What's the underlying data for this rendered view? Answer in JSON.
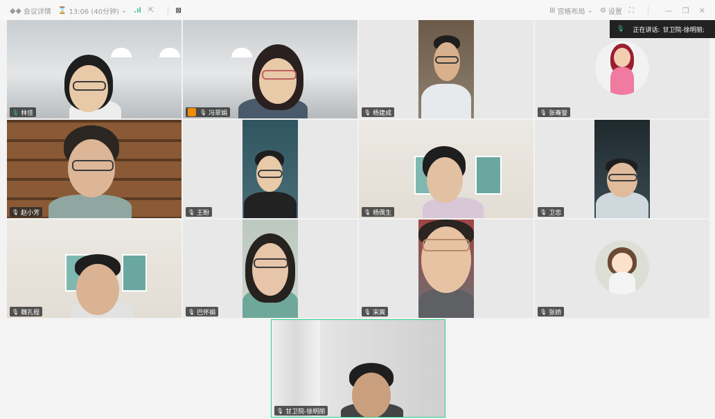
{
  "topbar": {
    "meeting_details": "会议详情",
    "time": "13:06 (40分钟)",
    "layout_label": "宫格布局",
    "settings_label": "设置"
  },
  "speaking": {
    "prefix": "正在讲话:",
    "speaker": "甘卫院-徐明丽;"
  },
  "participants": [
    {
      "name": "林佳"
    },
    {
      "name": "冯翠娟"
    },
    {
      "name": "杨建成"
    },
    {
      "name": "张骞誉"
    },
    {
      "name": "赵小芳"
    },
    {
      "name": "王盼"
    },
    {
      "name": "杨佩生"
    },
    {
      "name": "卫忠"
    },
    {
      "name": "魏孔程"
    },
    {
      "name": "巴怀娟"
    },
    {
      "name": "宋爽"
    },
    {
      "name": "张娇"
    },
    {
      "name": "甘卫院-徐明丽"
    }
  ],
  "colors": {
    "active_border": "#2fd08a",
    "host_badge": "#f08c00",
    "speaking_bg": "#222222"
  }
}
